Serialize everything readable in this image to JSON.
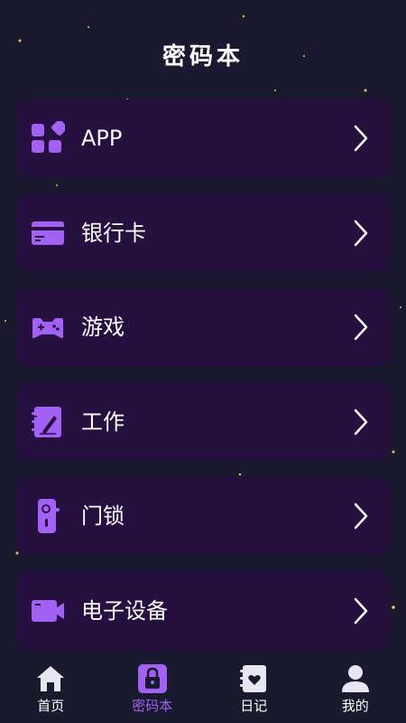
{
  "header": {
    "title": "密码本"
  },
  "categories": [
    {
      "label": "APP",
      "icon": "apps-grid-icon"
    },
    {
      "label": "银行卡",
      "icon": "bank-card-icon"
    },
    {
      "label": "游戏",
      "icon": "gamepad-icon"
    },
    {
      "label": "工作",
      "icon": "work-notebook-icon"
    },
    {
      "label": "门锁",
      "icon": "door-lock-icon"
    },
    {
      "label": "电子设备",
      "icon": "device-camera-icon"
    }
  ],
  "tabbar": {
    "tabs": [
      {
        "label": "首页",
        "icon": "home-icon",
        "active": false
      },
      {
        "label": "密码本",
        "icon": "lock-icon",
        "active": true
      },
      {
        "label": "日记",
        "icon": "diary-icon",
        "active": false
      },
      {
        "label": "我的",
        "icon": "user-icon",
        "active": false
      }
    ]
  },
  "colors": {
    "background": "#1b1930",
    "card": "#25103f",
    "accent": "#a261f2",
    "tabbar": "#1a1a2e",
    "star": "#f5c04a"
  }
}
